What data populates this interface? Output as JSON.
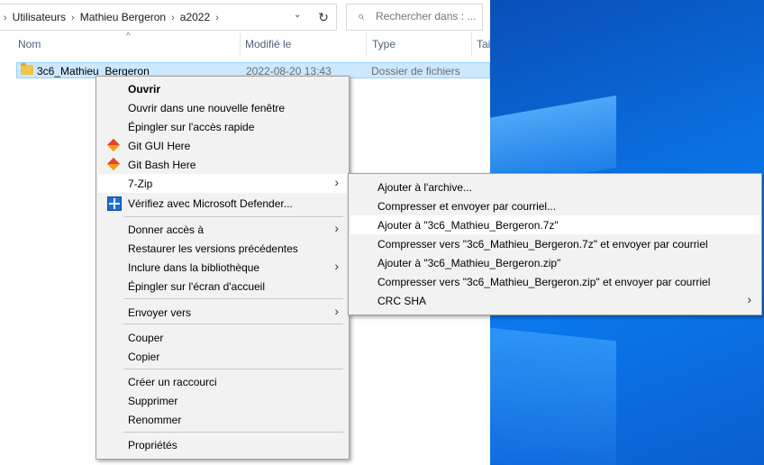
{
  "explorer": {
    "breadcrumb": [
      "Utilisateurs",
      "Mathieu Bergeron",
      "a2022"
    ],
    "search_placeholder": "Rechercher dans : ...",
    "columns": {
      "name": "Nom",
      "modified": "Modifié le",
      "type": "Type",
      "size": "Tai"
    },
    "file": {
      "name": "3c6_Mathieu_Bergeron",
      "modified": "2022-08-20 13:43",
      "type": "Dossier de fichiers"
    }
  },
  "context_menu": {
    "items": [
      {
        "label": "Ouvrir"
      },
      {
        "label": "Ouvrir dans une nouvelle fenêtre"
      },
      {
        "label": "Épingler sur l'accès rapide"
      },
      {
        "label": "Git GUI Here",
        "icon": "git-icon"
      },
      {
        "label": "Git Bash Here",
        "icon": "git-icon"
      },
      {
        "label": "7-Zip"
      },
      {
        "label": "Vérifiez avec Microsoft Defender...",
        "icon": "defender-shield-icon"
      },
      {
        "label": "Donner accès à"
      },
      {
        "label": "Restaurer les versions précédentes"
      },
      {
        "label": "Inclure dans la bibliothèque"
      },
      {
        "label": "Épingler sur l'écran d'accueil"
      },
      {
        "label": "Envoyer vers"
      },
      {
        "label": "Couper"
      },
      {
        "label": "Copier"
      },
      {
        "label": "Créer un raccourci"
      },
      {
        "label": "Supprimer"
      },
      {
        "label": "Renommer"
      },
      {
        "label": "Propriétés"
      }
    ]
  },
  "submenu_7zip": {
    "items": [
      {
        "label": "Ajouter à l'archive..."
      },
      {
        "label": "Compresser et envoyer par courriel..."
      },
      {
        "label": "Ajouter à \"3c6_Mathieu_Bergeron.7z\""
      },
      {
        "label": "Compresser vers \"3c6_Mathieu_Bergeron.7z\" et envoyer par courriel"
      },
      {
        "label": "Ajouter à \"3c6_Mathieu_Bergeron.zip\""
      },
      {
        "label": "Compresser vers \"3c6_Mathieu_Bergeron.zip\" et envoyer par courriel"
      },
      {
        "label": "CRC SHA"
      }
    ]
  },
  "icons": {
    "chevron": "›",
    "refresh": "↻",
    "search": "⌕",
    "dropdown": "⌄",
    "sort_up": "^"
  },
  "colors": {
    "selection_bg": "#cce8ff",
    "selection_border": "#99d1ff",
    "menu_bg": "#f2f2f2",
    "desktop_blue": "#0a6fe0"
  }
}
